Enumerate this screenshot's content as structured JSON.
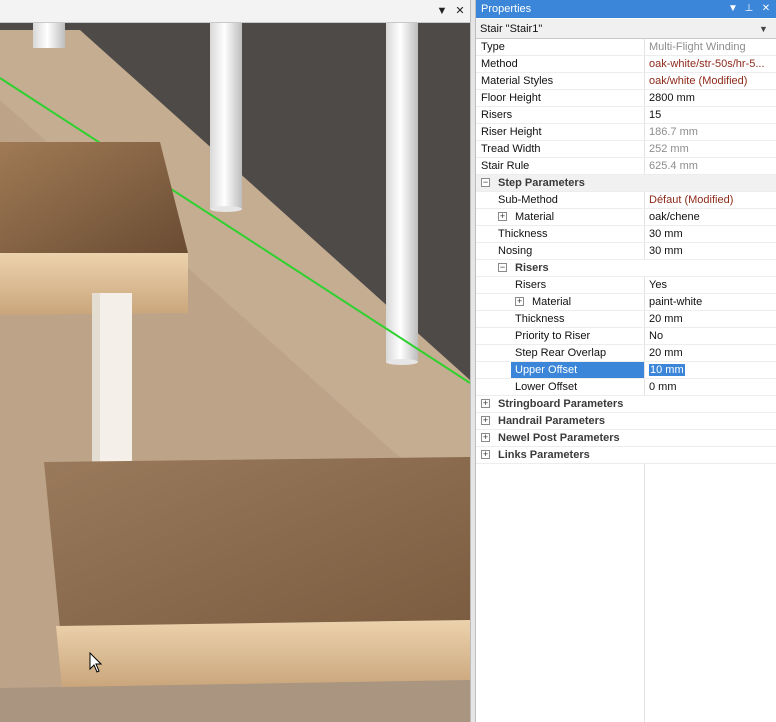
{
  "viewport": {
    "menu_glyph": "▼",
    "close_glyph": "✕"
  },
  "panel": {
    "title": "Properties",
    "menu_glyph": "▼",
    "pin_glyph": "⊥",
    "close_glyph": "✕",
    "object": "Stair \"Stair1\"",
    "dropdown_glyph": "▼"
  },
  "rows": [
    {
      "name": "Type",
      "value": "Multi-Flight Winding",
      "style": "ro"
    },
    {
      "name": "Method",
      "value": "oak-white/str-50s/hr-5...",
      "style": "mod"
    },
    {
      "name": "Material Styles",
      "value": "oak/white (Modified)",
      "style": "mod"
    },
    {
      "name": "Floor Height",
      "value": "2800 mm",
      "style": ""
    },
    {
      "name": "Risers",
      "value": "15",
      "style": ""
    },
    {
      "name": "Riser Height",
      "value": "186.7 mm",
      "style": "ro"
    },
    {
      "name": "Tread Width",
      "value": "252 mm",
      "style": "ro"
    },
    {
      "name": "Stair Rule",
      "value": "625.4 mm",
      "style": "ro"
    },
    {
      "name": "Step Parameters",
      "value": "",
      "style": ""
    },
    {
      "name": "Sub-Method",
      "value": "Défaut (Modified)",
      "style": "mod"
    },
    {
      "name": "Material",
      "value": "oak/chene",
      "style": ""
    },
    {
      "name": "Thickness",
      "value": "30 mm",
      "style": ""
    },
    {
      "name": "Nosing",
      "value": "30 mm",
      "style": ""
    },
    {
      "name": "Risers",
      "value": "",
      "style": ""
    },
    {
      "name": "Risers",
      "value": "Yes",
      "style": ""
    },
    {
      "name": "Material",
      "value": "paint-white",
      "style": ""
    },
    {
      "name": "Thickness",
      "value": "20 mm",
      "style": ""
    },
    {
      "name": "Priority to Riser",
      "value": "No",
      "style": ""
    },
    {
      "name": "Step Rear Overlap",
      "value": "20 mm",
      "style": ""
    },
    {
      "name": "Upper Offset",
      "value": "10 mm",
      "style": ""
    },
    {
      "name": "Lower Offset",
      "value": "0 mm",
      "style": ""
    },
    {
      "name": "Stringboard Parameters",
      "value": "",
      "style": ""
    },
    {
      "name": "Handrail Parameters",
      "value": "",
      "style": ""
    },
    {
      "name": "Newel Post Parameters",
      "value": "",
      "style": ""
    },
    {
      "name": "Links Parameters",
      "value": "",
      "style": ""
    }
  ],
  "expander_glyphs": {
    "expanded": "−",
    "collapsed": "+"
  },
  "colors": {
    "title_bar": "#3b86d8",
    "selection": "#3b86d8",
    "modified_text": "#8e2a1a",
    "readonly_text": "#8d8d8d",
    "guide_line": "#2fd12f",
    "wood": "#d3b08a"
  }
}
